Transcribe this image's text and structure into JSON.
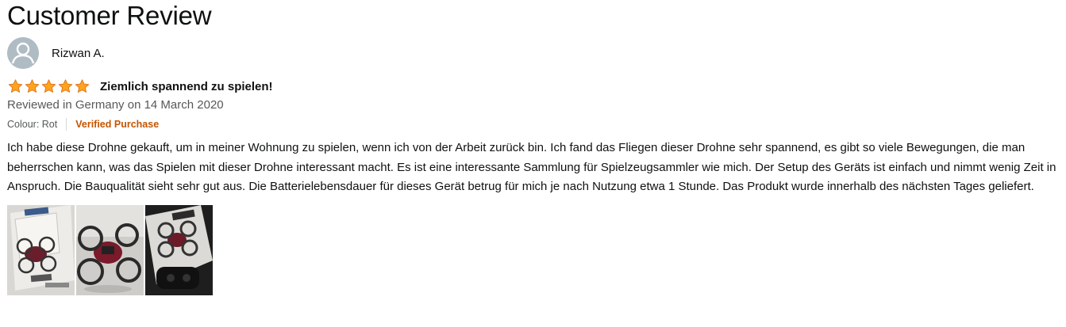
{
  "page": {
    "title": "Customer Review"
  },
  "review": {
    "reviewer_name": "Rizwan A.",
    "rating": 5,
    "rating_max": 5,
    "headline": "Ziemlich spannend zu spielen!",
    "date_line": "Reviewed in Germany on 14 March 2020",
    "colour_label": "Colour: Rot",
    "verified_label": "Verified Purchase",
    "body": "Ich habe diese Drohne gekauft, um in meiner Wohnung zu spielen, wenn ich von der Arbeit zurück bin. Ich fand das Fliegen dieser Drohne sehr spannend, es gibt so viele Bewegungen, die man beherrschen kann, was das Spielen mit dieser Drohne interessant macht. Es ist eine interessante Sammlung für Spielzeugsammler wie mich. Der Setup des Geräts ist einfach und nimmt wenig Zeit in Anspruch. Die Bauqualität sieht sehr gut aus. Die Batterielebensdauer für dieses Gerät betrug für mich je nach Nutzung etwa 1 Stunde. Das Produkt wurde innerhalb des nächsten Tages geliefert.",
    "images": [
      {
        "icon": "drone-photo-box"
      },
      {
        "icon": "drone-photo-closeup"
      },
      {
        "icon": "drone-photo-with-controller"
      }
    ]
  },
  "colors": {
    "star": "#ffa41c",
    "star_outline": "#de7921",
    "verified": "#c45500",
    "secondary_text": "#565959",
    "avatar_bg": "#b0bcc3"
  }
}
